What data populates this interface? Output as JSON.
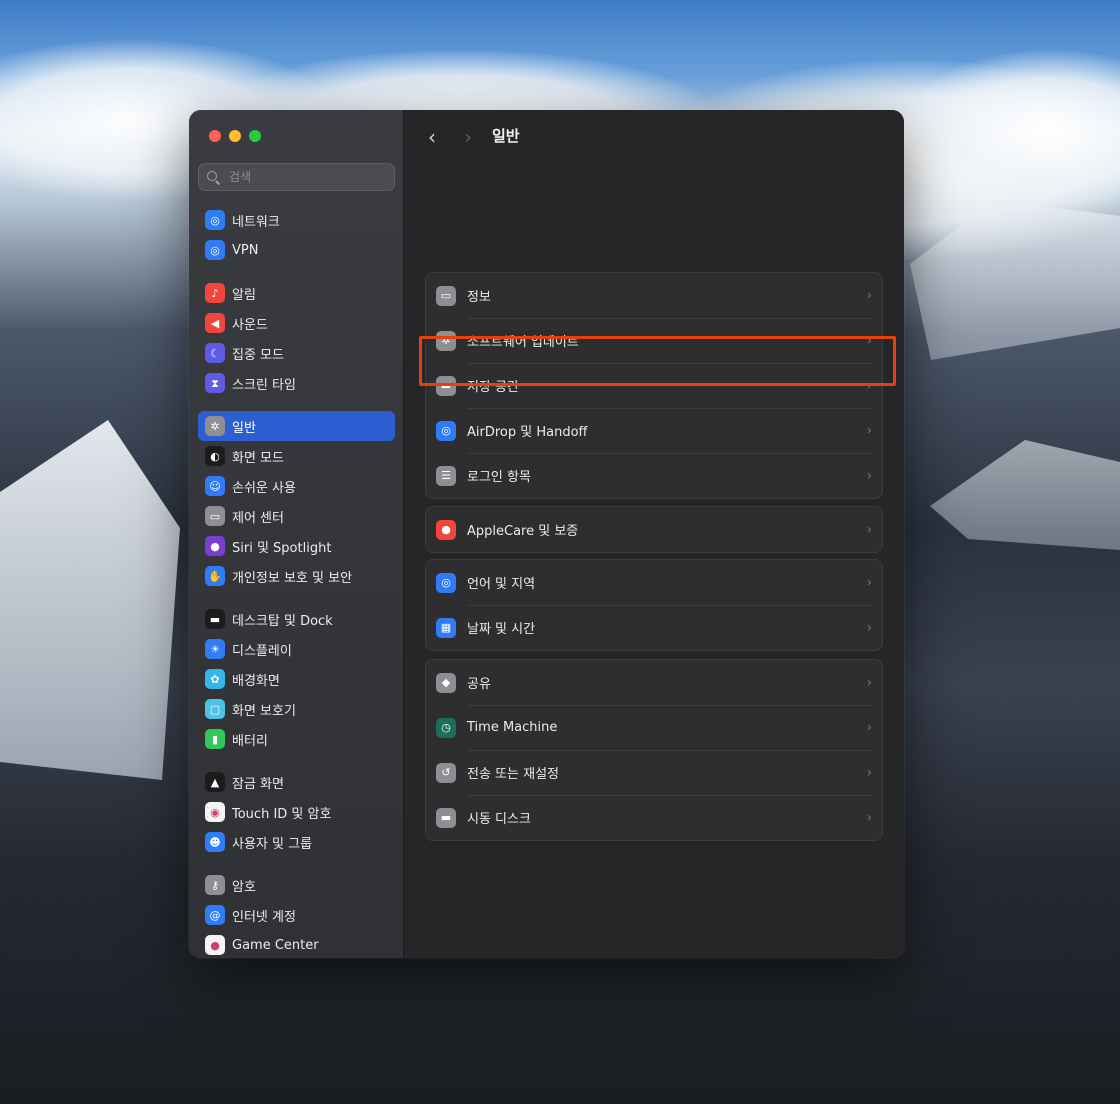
{
  "sidebar": {
    "search_placeholder": "검색",
    "groups": [
      [
        {
          "label": "네트워크",
          "icon": "globe-icon",
          "color": "#2f7cf6"
        },
        {
          "label": "VPN",
          "icon": "globe-icon",
          "color": "#2f7cf6"
        }
      ],
      [
        {
          "label": "알림",
          "icon": "bell-icon",
          "color": "#f2453d"
        },
        {
          "label": "사운드",
          "icon": "speaker-icon",
          "color": "#f2453d"
        },
        {
          "label": "집중 모드",
          "icon": "moon-icon",
          "color": "#5e5ce6"
        },
        {
          "label": "스크린 타임",
          "icon": "hourglass-icon",
          "color": "#5e5ce6"
        }
      ],
      [
        {
          "label": "일반",
          "icon": "gear-icon",
          "color": "#8e8e93",
          "selected": true
        },
        {
          "label": "화면 모드",
          "icon": "appearance-icon",
          "color": "#1c1c1e"
        },
        {
          "label": "손쉬운 사용",
          "icon": "accessibility-icon",
          "color": "#2f7cf6"
        },
        {
          "label": "제어 센터",
          "icon": "switches-icon",
          "color": "#8e8e93"
        },
        {
          "label": "Siri 및 Spotlight",
          "icon": "siri-icon",
          "color": "#7a3fd0"
        },
        {
          "label": "개인정보 보호 및 보안",
          "icon": "hand-icon",
          "color": "#2f7cf6"
        }
      ],
      [
        {
          "label": "데스크탑 및 Dock",
          "icon": "dock-icon",
          "color": "#1c1c1e"
        },
        {
          "label": "디스플레이",
          "icon": "sun-icon",
          "color": "#2f7cf6"
        },
        {
          "label": "배경화면",
          "icon": "flower-icon",
          "color": "#35b6e8"
        },
        {
          "label": "화면 보호기",
          "icon": "screensaver-icon",
          "color": "#4cc3e8"
        },
        {
          "label": "배터리",
          "icon": "battery-icon",
          "color": "#32c759"
        }
      ],
      [
        {
          "label": "잠금 화면",
          "icon": "lock-icon",
          "color": "#1c1c1e"
        },
        {
          "label": "Touch ID 및 암호",
          "icon": "fingerprint-icon",
          "color": "#f4f4f4"
        },
        {
          "label": "사용자 및 그룹",
          "icon": "users-icon",
          "color": "#2f7cf6"
        }
      ],
      [
        {
          "label": "암호",
          "icon": "key-icon",
          "color": "#8e8e93"
        },
        {
          "label": "인터넷 계정",
          "icon": "at-icon",
          "color": "#2f7cf6"
        },
        {
          "label": "Game Center",
          "icon": "game-center-icon",
          "color": "#f4f4f4"
        }
      ]
    ]
  },
  "header": {
    "title": "일반",
    "back_glyph": "‹",
    "forward_glyph": "›"
  },
  "settings_groups": [
    [
      {
        "label": "정보",
        "icon": "laptop-icon",
        "color": "#8e8e93"
      },
      {
        "label": "소프트웨어 업데이트",
        "icon": "gear-badge-icon",
        "color": "#8e8e93"
      },
      {
        "label": "저장 공간",
        "icon": "drive-icon",
        "color": "#8e8e93"
      },
      {
        "label": "AirDrop 및 Handoff",
        "icon": "airdrop-icon",
        "color": "#2f7cf6"
      },
      {
        "label": "로그인 항목",
        "icon": "list-icon",
        "color": "#8e8e93",
        "highlighted": true
      }
    ],
    [
      {
        "label": "AppleCare 및 보증",
        "icon": "apple-icon",
        "color": "#f2453d"
      }
    ],
    [
      {
        "label": "언어 및 지역",
        "icon": "globe-icon",
        "color": "#2f7cf6"
      },
      {
        "label": "날짜 및 시간",
        "icon": "calendar-clock-icon",
        "color": "#2f7cf6"
      }
    ],
    [
      {
        "label": "공유",
        "icon": "sharing-icon",
        "color": "#8e8e93"
      },
      {
        "label": "Time Machine",
        "icon": "time-machine-icon",
        "color": "#1f6e5a"
      },
      {
        "label": "전송 또는 재설정",
        "icon": "reset-icon",
        "color": "#8e8e93"
      },
      {
        "label": "시동 디스크",
        "icon": "disk-icon",
        "color": "#8e8e93"
      }
    ]
  ],
  "highlight_color": "#e8400c"
}
